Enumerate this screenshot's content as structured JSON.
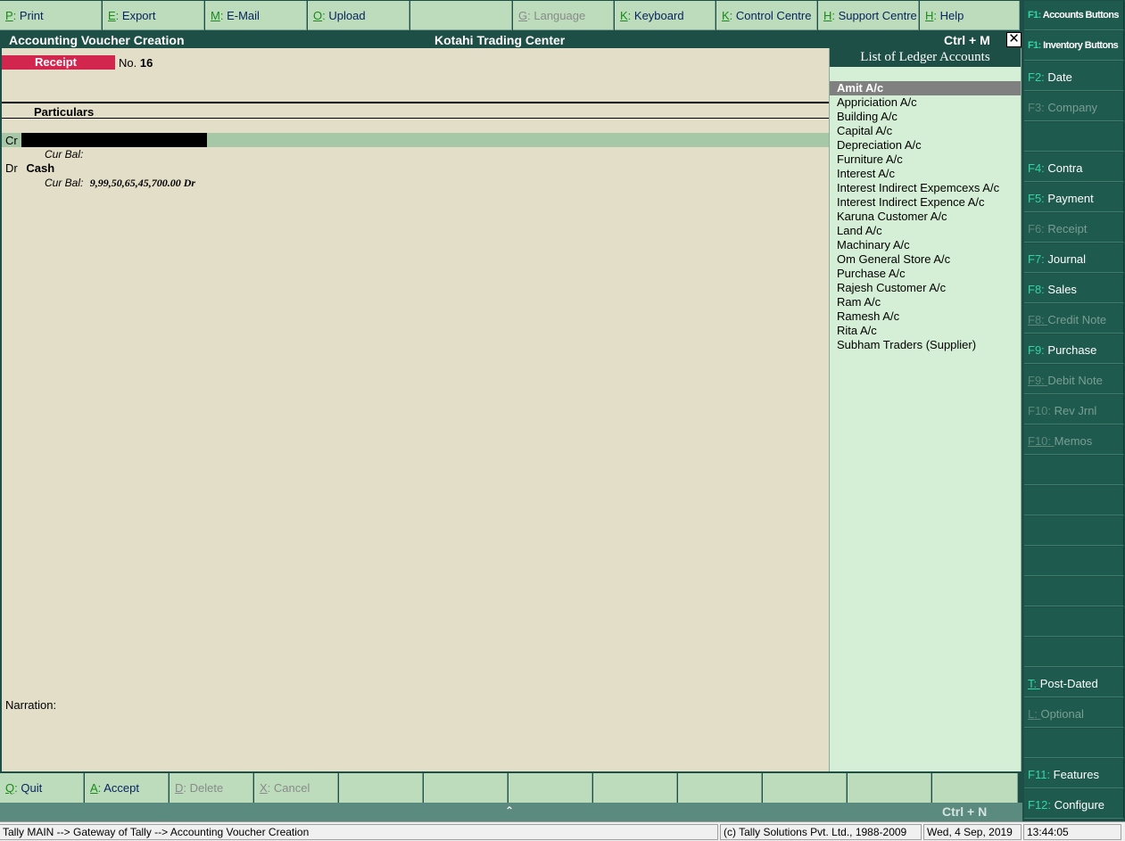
{
  "toolbar": {
    "buttons": [
      {
        "key": "P",
        "label": "Print",
        "enabled": true
      },
      {
        "key": "E",
        "label": "Export",
        "enabled": true
      },
      {
        "key": "M",
        "label": "E-Mail",
        "enabled": true
      },
      {
        "key": "O",
        "label": "Upload",
        "enabled": true
      },
      {
        "key": "",
        "label": "",
        "enabled": true
      },
      {
        "key": "G",
        "label": "Language",
        "enabled": false
      },
      {
        "key": "K",
        "label": "Keyboard",
        "enabled": true
      },
      {
        "key": "K",
        "label": "Control Centre",
        "enabled": true
      },
      {
        "key": "H",
        "label": "Support Centre",
        "enabled": true
      },
      {
        "key": "H",
        "label": "Help",
        "enabled": true
      }
    ]
  },
  "titlebar": {
    "screen_title": "Accounting Voucher  Creation",
    "company": "Kotahi Trading Center",
    "shortcut": "Ctrl + M",
    "close_glyph": "✕"
  },
  "voucher": {
    "type": "Receipt",
    "no_label": "No.",
    "number": "16",
    "particulars_header": "Particulars",
    "cr_label": "Cr",
    "cr_value": "",
    "cur_bal_label": "Cur Bal:",
    "dr_label": "Dr",
    "dr_account": "Cash",
    "dr_cur_bal": "9,99,50,65,45,700.00 Dr",
    "narration_label": "Narration:"
  },
  "ledger_list": {
    "title": "List of Ledger Accounts",
    "selected_index": 0,
    "items": [
      "Amit A/c",
      "Appriciation A/c",
      "Building A/c",
      "Capital A/c",
      "Depreciation A/c",
      "Furniture A/c",
      "Interest A/c",
      "Interest Indirect Expemcexs A/c",
      "Interest Indirect Expence A/c",
      "Karuna Customer A/c",
      "Land A/c",
      "Machinary A/c",
      "Om General Store A/c",
      "Purchase A/c",
      "Rajesh  Customer A/c",
      "Ram A/c",
      "Ramesh  A/c",
      "Rita A/c",
      "Subham Traders (Supplier)"
    ]
  },
  "function_panel": {
    "buttons": [
      {
        "key": "F1",
        "label": "Accounts Buttons",
        "enabled": true,
        "style": "cond"
      },
      {
        "key": "F1",
        "label": "Inventory Buttons",
        "enabled": true,
        "style": "cond"
      },
      {
        "key": "F2",
        "label": "Date",
        "enabled": true
      },
      {
        "key": "F3",
        "label": "Company",
        "enabled": false
      },
      {
        "key": "",
        "label": "",
        "enabled": true
      },
      {
        "key": "F4",
        "label": "Contra",
        "enabled": true
      },
      {
        "key": "F5",
        "label": "Payment",
        "enabled": true
      },
      {
        "key": "F6",
        "label": "Receipt",
        "enabled": false
      },
      {
        "key": "F7",
        "label": "Journal",
        "enabled": true
      },
      {
        "key": "F8",
        "label": "Sales",
        "enabled": true
      },
      {
        "key": "F8",
        "label": "Credit Note",
        "enabled": false,
        "underline": true
      },
      {
        "key": "F9",
        "label": "Purchase",
        "enabled": true
      },
      {
        "key": "F9",
        "label": "Debit Note",
        "enabled": false,
        "underline": true
      },
      {
        "key": "F10",
        "label": "Rev Jrnl",
        "enabled": false
      },
      {
        "key": "F10",
        "label": "Memos",
        "enabled": false,
        "underline": true
      },
      {
        "key": "",
        "label": "",
        "enabled": true
      },
      {
        "key": "",
        "label": "",
        "enabled": true
      },
      {
        "key": "",
        "label": "",
        "enabled": true
      },
      {
        "key": "",
        "label": "",
        "enabled": true
      },
      {
        "key": "",
        "label": "",
        "enabled": true
      },
      {
        "key": "",
        "label": "",
        "enabled": true
      },
      {
        "key": "",
        "label": "",
        "enabled": true
      },
      {
        "key": "T",
        "label": "Post-Dated",
        "enabled": true,
        "underline": true
      },
      {
        "key": "L",
        "label": "Optional",
        "enabled": false,
        "underline": true
      },
      {
        "key": "",
        "label": "",
        "enabled": true
      },
      {
        "key": "F11",
        "label": "Features",
        "enabled": true
      },
      {
        "key": "F12",
        "label": "Configure",
        "enabled": true
      }
    ]
  },
  "bottombar": {
    "buttons": [
      {
        "key": "Q",
        "label": "Quit",
        "enabled": true
      },
      {
        "key": "A",
        "label": "Accept",
        "enabled": true
      },
      {
        "key": "D",
        "label": "Delete",
        "enabled": false
      },
      {
        "key": "X",
        "label": "Cancel",
        "enabled": false
      },
      {
        "key": "",
        "label": "",
        "enabled": true
      },
      {
        "key": "",
        "label": "",
        "enabled": true
      },
      {
        "key": "",
        "label": "",
        "enabled": true
      },
      {
        "key": "",
        "label": "",
        "enabled": true
      },
      {
        "key": "",
        "label": "",
        "enabled": true
      },
      {
        "key": "",
        "label": "",
        "enabled": true
      },
      {
        "key": "",
        "label": "",
        "enabled": true
      },
      {
        "key": "",
        "label": "",
        "enabled": true
      }
    ],
    "caret_glyph": "⌃",
    "shortcut": "Ctrl + N"
  },
  "statusbar": {
    "path": "Tally MAIN --> Gateway of Tally --> Accounting Voucher  Creation",
    "copyright": "(c) Tally Solutions Pvt. Ltd., 1988-2009",
    "date": "Wed, 4 Sep, 2019",
    "time": "13:44:05"
  },
  "colors": {
    "panel_dark": "#1e4f46",
    "button_light": "#bcdcbc",
    "voucher_bg": "#e3dec8",
    "ledger_bg": "#d5efd6",
    "receipt_badge": "#d3264f",
    "key_green": "#1a8a1a",
    "fkey_teal": "#33d6a4"
  }
}
